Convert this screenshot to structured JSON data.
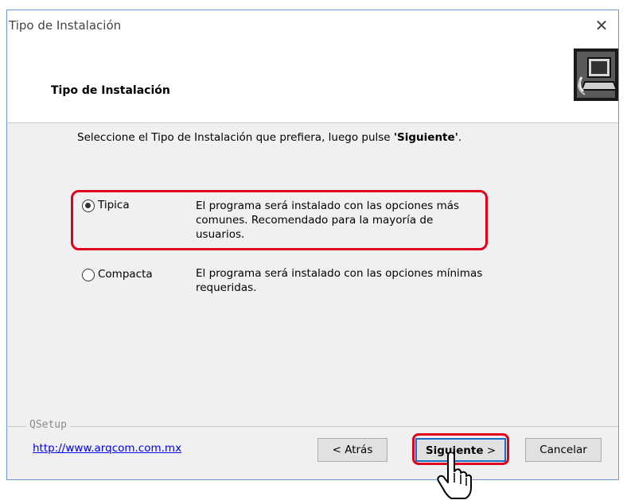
{
  "window": {
    "title": "Tipo de Instalación",
    "close_glyph": "✕"
  },
  "header": {
    "title": "Tipo de Instalación",
    "icon": "installer-computer-icon"
  },
  "instruction": {
    "text_before": "Seleccione el Tipo de Instalación que prefiera, luego pulse ",
    "bold": "'Siguiente'",
    "text_after": "."
  },
  "options": [
    {
      "label": "Tipica",
      "selected": true,
      "description_lines": [
        "El programa será instalado con las opciones más",
        "comunes. Recomendado para la mayoría de",
        "usuarios."
      ]
    },
    {
      "label": "Compacta",
      "selected": false,
      "description_lines": [
        "El programa será instalado con las opciones mínimas",
        "requeridas."
      ]
    }
  ],
  "footer": {
    "group_label": "QSetup",
    "link": "http://www.arqcom.com.mx"
  },
  "buttons": {
    "back": "< Atrás",
    "next_bold": "Siguiente",
    "next_suffix": " >",
    "cancel": "Cancelar"
  },
  "colors": {
    "highlight": "#e0001b",
    "link": "#0000ee",
    "dialog_bg": "#f0f0f0",
    "default_button_border": "#1a6ec9"
  }
}
